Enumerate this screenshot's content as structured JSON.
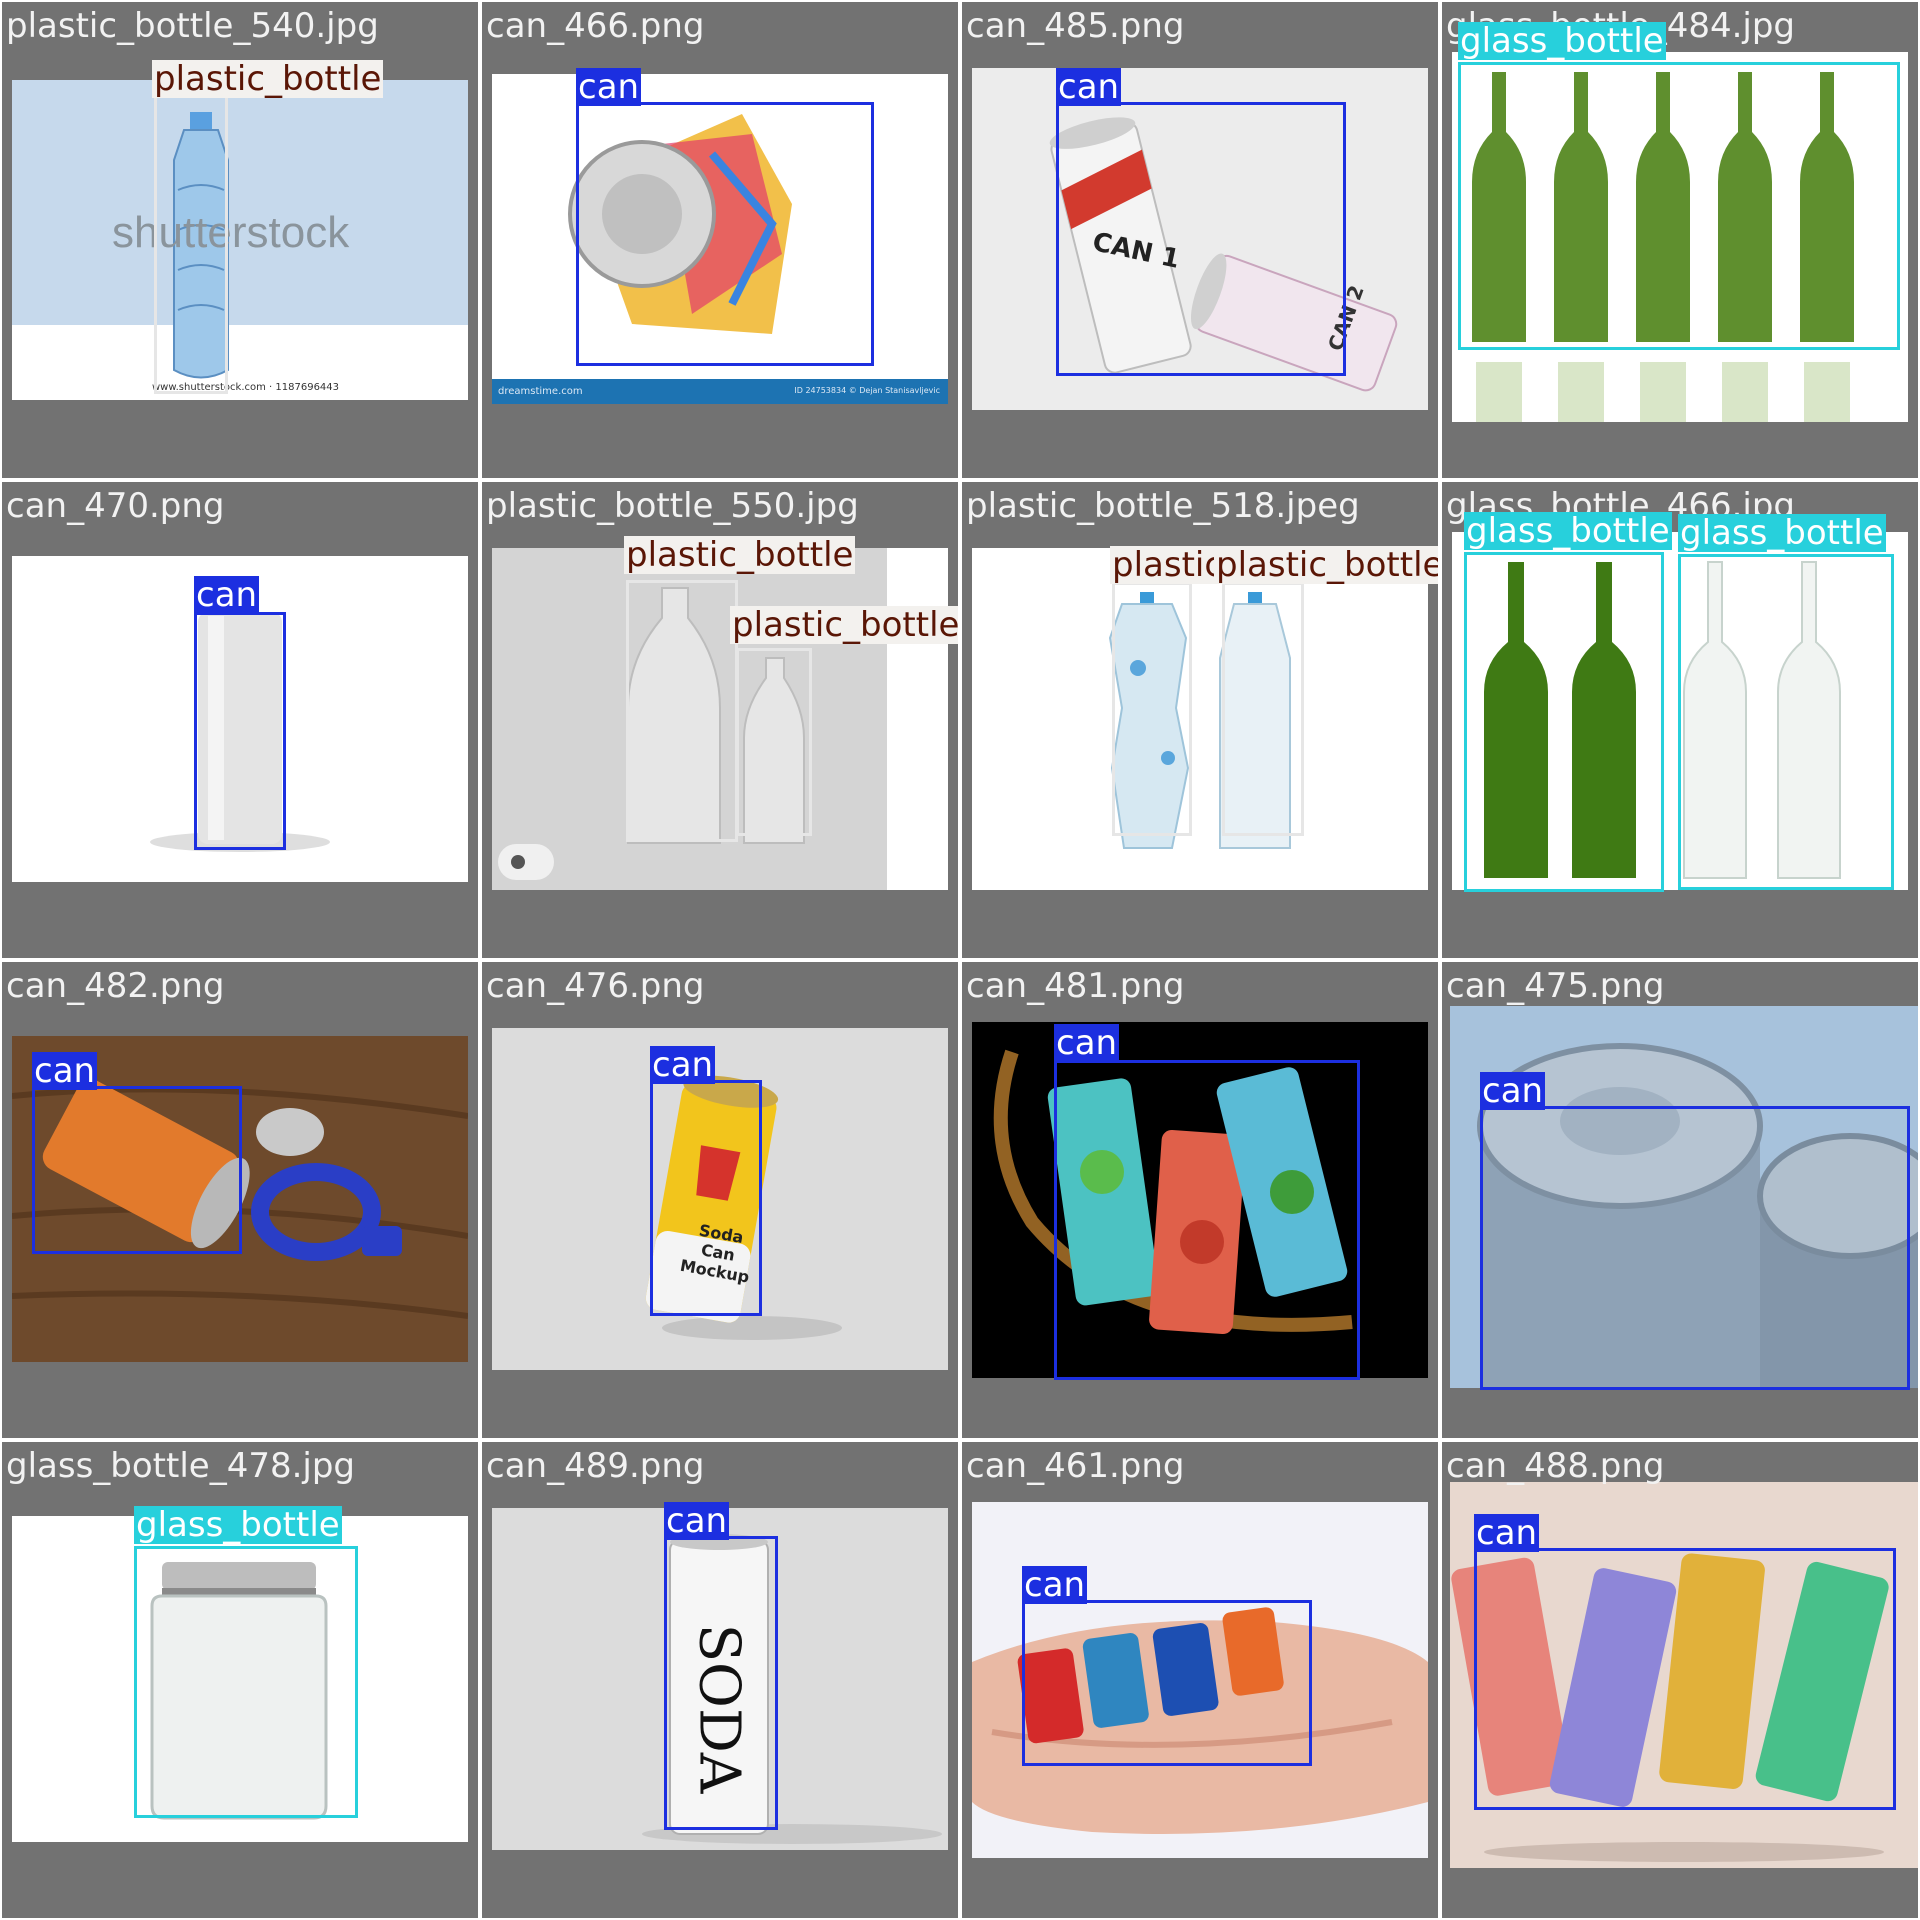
{
  "grid_title": "",
  "colors": {
    "can": "#1c2fe0",
    "plastic_bottle": "#e6e6e6",
    "glass_bottle": "#27d0dc",
    "cell_bg": "#727272"
  },
  "tiles": [
    {
      "filename": "plastic_bottle_540.jpg",
      "labels": [
        "plastic_bottle"
      ],
      "watermark": "shutterstock",
      "caption": "www.shutterstock.com · 1187696443"
    },
    {
      "filename": "can_466.png",
      "labels": [
        "can"
      ],
      "footer_left": "dreamstime.com",
      "footer_right": "ID 24753834 © Dejan Stanisavljevic"
    },
    {
      "filename": "can_485.png",
      "labels": [
        "can"
      ],
      "can_text_1": "CAN 1",
      "can_text_2": "CAN 2"
    },
    {
      "filename": "glass_bottle_484.jpg",
      "labels": [
        "glass_bottle"
      ]
    },
    {
      "filename": "can_470.png",
      "labels": [
        "can"
      ]
    },
    {
      "filename": "plastic_bottle_550.jpg",
      "labels": [
        "plastic_bottle",
        "plastic_bottle"
      ]
    },
    {
      "filename": "plastic_bottle_518.jpeg",
      "labels": [
        "plastic",
        "plastic_bottle"
      ]
    },
    {
      "filename": "glass_bottle_466.jpg",
      "labels": [
        "glass_bottle",
        "glass_bottle"
      ]
    },
    {
      "filename": "can_482.png",
      "labels": [
        "can"
      ]
    },
    {
      "filename": "can_476.png",
      "labels": [
        "can"
      ],
      "can_text": "Soda Can Mockup"
    },
    {
      "filename": "can_481.png",
      "labels": [
        "can"
      ]
    },
    {
      "filename": "can_475.png",
      "labels": [
        "can"
      ]
    },
    {
      "filename": "glass_bottle_478.jpg",
      "labels": [
        "glass_bottle"
      ]
    },
    {
      "filename": "can_489.png",
      "labels": [
        "can"
      ],
      "can_text": "SODA"
    },
    {
      "filename": "can_461.png",
      "labels": [
        "can"
      ]
    },
    {
      "filename": "can_488.png",
      "labels": [
        "can"
      ]
    }
  ]
}
